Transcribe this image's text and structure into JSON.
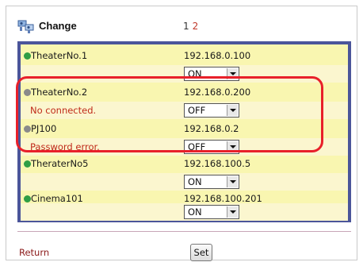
{
  "header": {
    "title": "Change",
    "icon": "devices-icon",
    "pages": [
      "1",
      "2"
    ],
    "current_page": "1"
  },
  "devices": [
    {
      "name": "TheaterNo.1",
      "ip": "192.168.0.100",
      "state": "ON",
      "status": "",
      "indicator": "green"
    },
    {
      "name": "TheaterNo.2",
      "ip": "192.168.0.200",
      "state": "OFF",
      "status": "No connected.",
      "indicator": "gray"
    },
    {
      "name": "PJ100",
      "ip": "192.168.0.2",
      "state": "OFF",
      "status": "Password error.",
      "indicator": "gray"
    },
    {
      "name": "TheraterNo5",
      "ip": "192.168.100.5",
      "state": "ON",
      "status": "",
      "indicator": "green"
    },
    {
      "name": "Cinema101",
      "ip": "192.168.100.201",
      "state": "ON",
      "status": "",
      "indicator": "green"
    }
  ],
  "footer": {
    "return_label": "Return",
    "set_label": "Set"
  },
  "colors": {
    "list_border": "#4b559a",
    "list_bg": "#f9f6b0",
    "highlight": "#e8202a",
    "status_text": "#c02a1a",
    "indicator_on": "#2f9e44",
    "indicator_off": "#8a8a8a"
  }
}
